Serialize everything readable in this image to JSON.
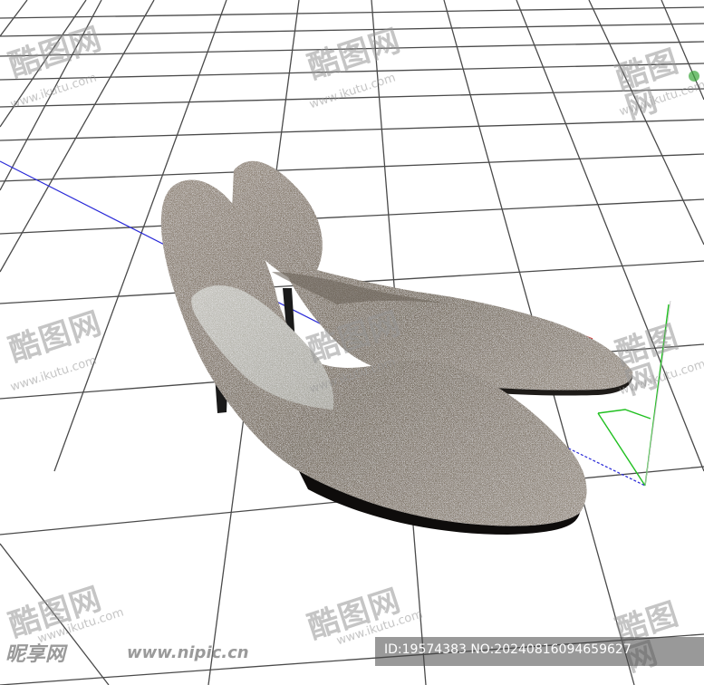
{
  "watermarks": {
    "site_name": "酷图网",
    "site_url": "www.ikutu.com",
    "nipic_logo": "昵享网",
    "nipic_url": "www.nipic.cn"
  },
  "id_bar": {
    "text": "ID:19574383 NO:20240816094659627"
  },
  "colors": {
    "grid": "#4a4a4a",
    "x_axis_blue": "#2a2ad8",
    "axis_red": "#e02020",
    "axis_green": "#20c020",
    "shoe_glitter": "#8c8378",
    "insole": "#b9b8b0",
    "heel": "#1a1a1a"
  }
}
